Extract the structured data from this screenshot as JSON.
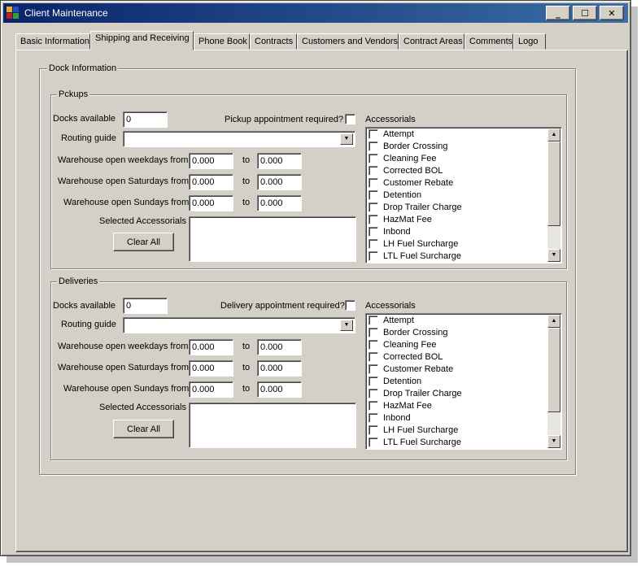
{
  "window": {
    "title": "Client Maintenance",
    "minimize_glyph": "_",
    "maximize_glyph": "☐",
    "close_glyph": "✕"
  },
  "tabs": [
    {
      "label": "Basic Information",
      "active": false
    },
    {
      "label": "Shipping and Receiving",
      "active": true
    },
    {
      "label": "Phone Book",
      "active": false
    },
    {
      "label": "Contracts",
      "active": false
    },
    {
      "label": "Customers and Vendors",
      "active": false
    },
    {
      "label": "Contract Areas",
      "active": false
    },
    {
      "label": "Comments",
      "active": false
    },
    {
      "label": "Logo",
      "active": false
    }
  ],
  "dock_information": {
    "label": "Dock Information",
    "pickups": {
      "label": "Pckups",
      "docks_label": "Docks available",
      "docks_value": "0",
      "appointment_label": "Pickup appointment required?",
      "appointment_checked": false,
      "routing_label": "Routing guide",
      "routing_value": "",
      "weekdays_label": "Warehouse open weekdays from",
      "weekdays_from": "0.000",
      "weekdays_to": "0.000",
      "saturdays_label": "Warehouse open Saturdays from",
      "saturdays_from": "0.000",
      "saturdays_to": "0.000",
      "sundays_label": "Warehouse open Sundays from",
      "sundays_from": "0.000",
      "sundays_to": "0.000",
      "to_label": "to",
      "selected_label": "Selected Accessorials",
      "clear_label": "Clear All",
      "accessorials_label": "Accessorials",
      "accessorials": [
        "Attempt",
        "Border Crossing",
        "Cleaning Fee",
        "Corrected BOL",
        "Customer Rebate",
        "Detention",
        "Drop Trailer Charge",
        "HazMat Fee",
        "Inbond",
        "LH Fuel Surcharge",
        "LTL Fuel Surcharge"
      ]
    },
    "deliveries": {
      "label": "Deliveries",
      "docks_label": "Docks available",
      "docks_value": "0",
      "appointment_label": "Delivery appointment required?",
      "appointment_checked": false,
      "routing_label": "Routing guide",
      "routing_value": "",
      "weekdays_label": "Warehouse open weekdays from",
      "weekdays_from": "0.000",
      "weekdays_to": "0.000",
      "saturdays_label": "Warehouse open Saturdays from",
      "saturdays_from": "0.000",
      "saturdays_to": "0.000",
      "sundays_label": "Warehouse open Sundays from",
      "sundays_from": "0.000",
      "sundays_to": "0.000",
      "to_label": "to",
      "selected_label": "Selected Accessorials",
      "clear_label": "Clear All",
      "accessorials_label": "Accessorials",
      "accessorials": [
        "Attempt",
        "Border Crossing",
        "Cleaning Fee",
        "Corrected BOL",
        "Customer Rebate",
        "Detention",
        "Drop Trailer Charge",
        "HazMat Fee",
        "Inbond",
        "LH Fuel Surcharge",
        "LTL Fuel Surcharge"
      ]
    }
  },
  "icons": {
    "app": "app-icon",
    "combo_arrow": "▼",
    "scroll_up": "▲",
    "scroll_down": "▼"
  },
  "colors": {
    "title_start": "#0a246a",
    "title_end": "#3a6ea5",
    "face": "#d4d0c8"
  }
}
